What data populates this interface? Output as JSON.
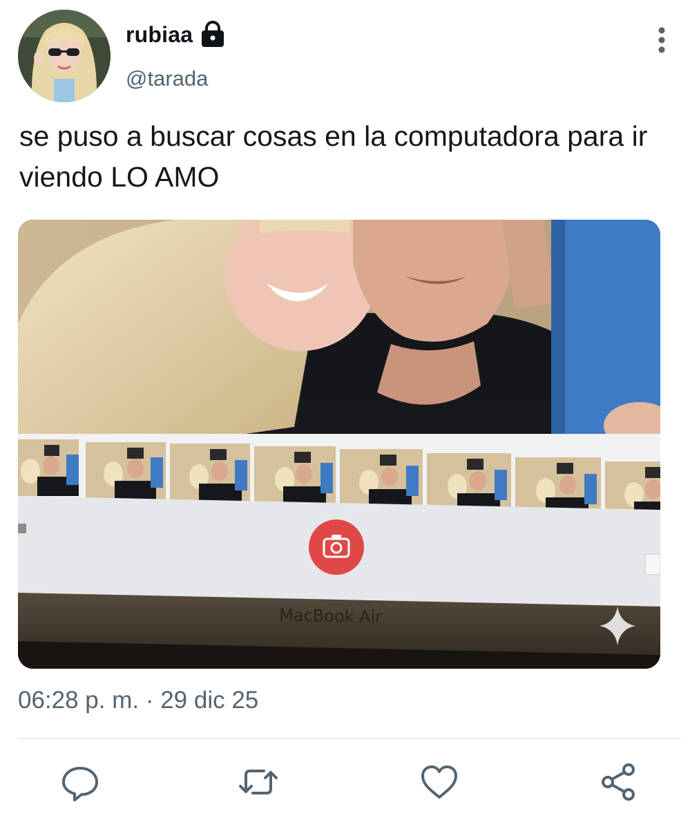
{
  "user": {
    "display_name": "rubiaa",
    "handle": "@tarada",
    "protected_icon": "lock-icon",
    "avatar_icon": "avatar"
  },
  "tweet": {
    "text": "se puso a buscar cosas en la computadora para ir viendo LO AMO",
    "timestamp": "06:28 p. m. · 29 dic 25"
  },
  "media": {
    "brand_label": "MacBook Air",
    "thumbnail_count": 8
  },
  "actions": {
    "reply_icon": "reply-icon",
    "retweet_icon": "retweet-icon",
    "like_icon": "heart-icon",
    "share_icon": "share-icon",
    "more_icon": "more-vertical-icon"
  },
  "colors": {
    "icon_gray": "#536471",
    "text": "#14171a",
    "camera_red": "#e04848"
  }
}
